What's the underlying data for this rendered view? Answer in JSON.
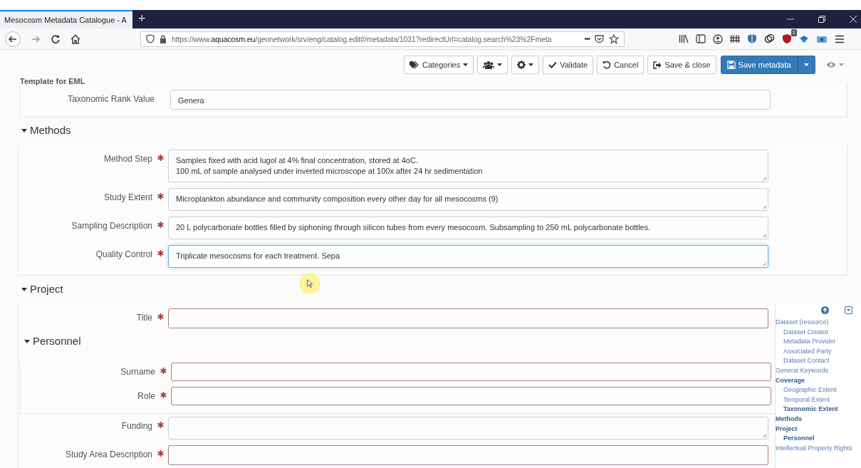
{
  "browser": {
    "tab_title": "Mesocosm Metadata Catalogue - A",
    "new_tab": "+",
    "url_prefix": "https://www.",
    "url_domain": "aquacosm.eu",
    "url_path": "/geonetwork/srv/eng/catalog.edit#/metadata/1031?redirectUrl=catalog.search%23%2Fmeta",
    "url_more": "•••",
    "extension_badge": "1"
  },
  "toolbar": {
    "buttons": [
      {
        "kind": "tags",
        "label": "Categories",
        "caret": true
      },
      {
        "kind": "users",
        "caret": true
      },
      {
        "kind": "gear",
        "caret": true
      },
      {
        "kind": "check",
        "label": "Validate",
        "caret": false
      },
      {
        "kind": "undo",
        "label": "Cancel",
        "caret": false
      },
      {
        "kind": "exit",
        "label": "Save & close",
        "caret": false
      },
      {
        "kind": "save",
        "label": "Save metadata",
        "caret": true
      },
      {
        "kind": "eye",
        "caret": true
      }
    ]
  },
  "template_title": "Template for EML",
  "top_field": {
    "label": "Taxonomic Rank Value",
    "value": "Genera"
  },
  "sections": [
    {
      "title": "Methods",
      "expanded": true,
      "fields": [
        {
          "kind": "textarea",
          "label": "Method Step",
          "required": true,
          "value": "Samples fixed with acid lugol at 4% final concentration, stored at 4oC.\n100 mL of sample analysed under inverted microscope at 100x after 24 hr sedimentation",
          "focused": false,
          "invalid": false
        },
        {
          "kind": "textarea",
          "label": "Study Extent",
          "required": true,
          "value": "Microplankton abundance and community composition every other day for all mesocosms (9)",
          "focused": false,
          "invalid": false
        },
        {
          "kind": "textarea",
          "label": "Sampling Description",
          "required": true,
          "value": "20 L polycarbonate bottles filled by siphoning through silicon tubes from every mesocosm. Subsampling to 250 mL polycarbonate bottles.",
          "focused": false,
          "invalid": false
        },
        {
          "kind": "textarea",
          "label": "Quality Control",
          "required": true,
          "value": "Triplicate mesocosms for each treatment. Sepa",
          "focused": true,
          "invalid": false
        }
      ]
    },
    {
      "title": "Project",
      "expanded": true,
      "fields": [
        {
          "kind": "input",
          "label": "Title",
          "required": true,
          "focused": false,
          "invalid": true
        }
      ],
      "subsection": {
        "title": "Personnel",
        "expanded": true,
        "fields": [
          {
            "kind": "input",
            "label": "Surname",
            "required": true,
            "focused": false,
            "invalid": true
          },
          {
            "kind": "input",
            "label": "Role",
            "required": true,
            "focused": false,
            "invalid": true
          }
        ]
      },
      "fields_after": [
        {
          "kind": "textarea",
          "label": "Funding",
          "required": true,
          "focused": false,
          "invalid": false
        },
        {
          "kind": "input",
          "label": "Study Area Description",
          "required": true,
          "focused": false,
          "invalid": true
        }
      ]
    }
  ],
  "toc": [
    {
      "label": "Dataset (resource)",
      "active": false,
      "children": [
        {
          "label": "Dataset Creator",
          "active": false
        },
        {
          "label": "Metadata Provider",
          "active": false
        },
        {
          "label": "Associated Party",
          "active": false
        },
        {
          "label": "Dataset Contact",
          "active": false
        }
      ]
    },
    {
      "label": "General Keywords",
      "active": false
    },
    {
      "label": "Coverage",
      "active": true,
      "children": [
        {
          "label": "Geographic Extent",
          "active": false
        },
        {
          "label": "Temporal Extent",
          "active": false
        },
        {
          "label": "Taxonomic Extent",
          "active": true
        }
      ]
    },
    {
      "label": "Methods",
      "active": true
    },
    {
      "label": "Project",
      "active": true,
      "children": [
        {
          "label": "Personnel",
          "active": true
        }
      ]
    },
    {
      "label": "Intellectual Property Rights",
      "active": false
    }
  ]
}
